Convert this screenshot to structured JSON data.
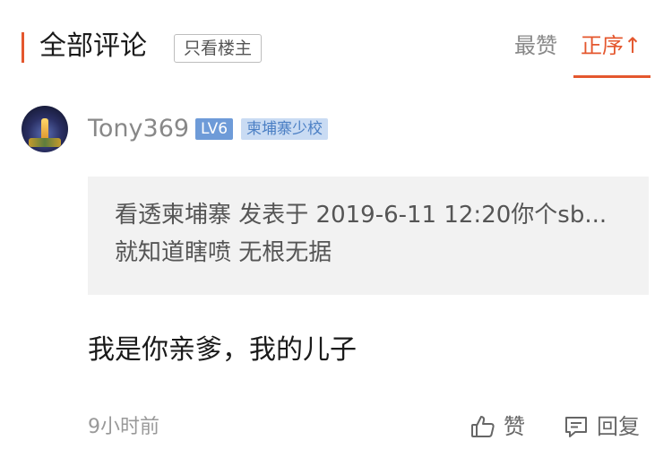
{
  "header": {
    "title": "全部评论",
    "filter_label": "只看楼主",
    "sort_hot": "最赞",
    "sort_order": "正序",
    "sort_order_arrow": "↑",
    "accent_color": "#e4572e"
  },
  "comment": {
    "username": "Tony369",
    "level_badge": "LV6",
    "title_badge": "柬埔寨少校",
    "quote_text": "看透柬埔寨 发表于 2019-6-11 12:20你个sb... 就知道瞎喷 无根无据",
    "body": "我是你亲爹，我的儿子",
    "timestamp": "9小时前",
    "like_label": "赞",
    "reply_label": "回复",
    "like_icon": "thumbs-up-icon",
    "reply_icon": "comment-icon"
  }
}
